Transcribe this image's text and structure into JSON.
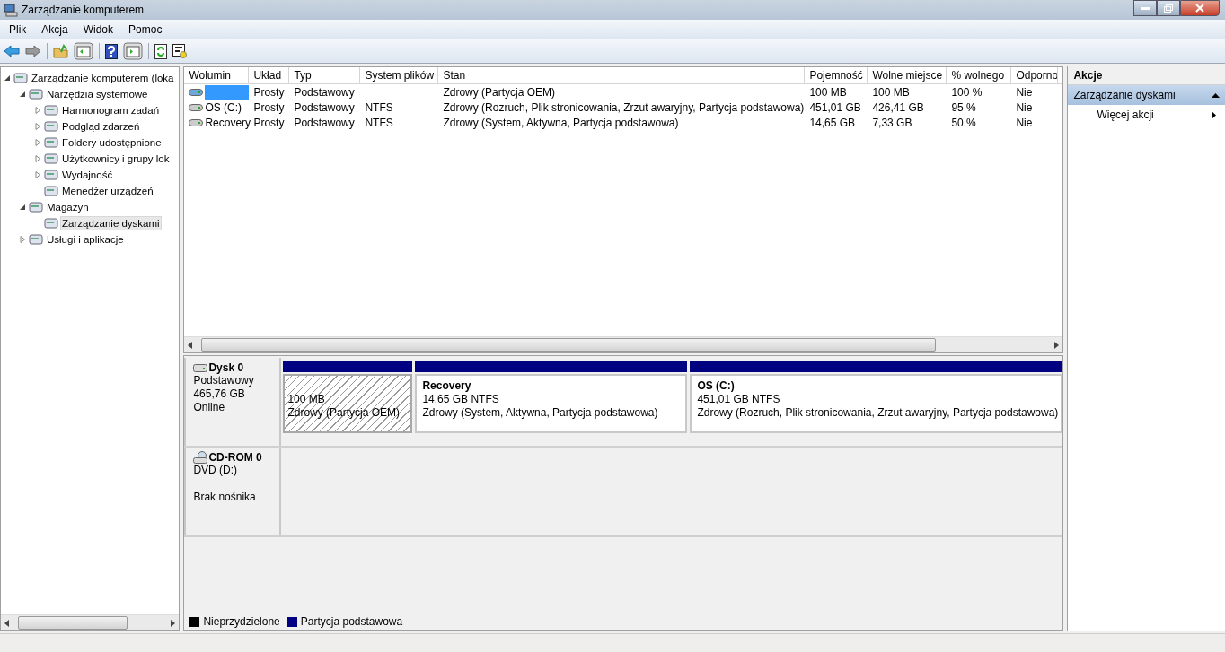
{
  "window": {
    "title": "Zarządzanie komputerem"
  },
  "menu": [
    "Plik",
    "Akcja",
    "Widok",
    "Pomoc"
  ],
  "tree": [
    {
      "label": "Zarządzanie komputerem (loka",
      "expanded": true,
      "selected": false,
      "children": [
        {
          "label": "Narzędzia systemowe",
          "expanded": true,
          "selected": false,
          "children": [
            {
              "label": "Harmonogram zadań",
              "expanded": false,
              "selected": false
            },
            {
              "label": "Podgląd zdarzeń",
              "expanded": false,
              "selected": false
            },
            {
              "label": "Foldery udostępnione",
              "expanded": false,
              "selected": false
            },
            {
              "label": "Użytkownicy i grupy lok",
              "expanded": false,
              "selected": false
            },
            {
              "label": "Wydajność",
              "expanded": false,
              "selected": false
            },
            {
              "label": "Menedżer urządzeń",
              "selected": false
            }
          ]
        },
        {
          "label": "Magazyn",
          "expanded": true,
          "selected": false,
          "children": [
            {
              "label": "Zarządzanie dyskami",
              "selected": true
            }
          ]
        },
        {
          "label": "Usługi i aplikacje",
          "expanded": false,
          "selected": false
        }
      ]
    }
  ],
  "table": {
    "columns": [
      "Wolumin",
      "Układ",
      "Typ",
      "System plików",
      "Stan",
      "Pojemność",
      "Wolne miejsce",
      "% wolnego",
      "Odporno"
    ],
    "rows": [
      {
        "selected": true,
        "cells": [
          "",
          "Prosty",
          "Podstawowy",
          "",
          "Zdrowy (Partycja OEM)",
          "100 MB",
          "100 MB",
          "100 %",
          "Nie"
        ]
      },
      {
        "selected": false,
        "cells": [
          "OS (C:)",
          "Prosty",
          "Podstawowy",
          "NTFS",
          "Zdrowy (Rozruch, Plik stronicowania, Zrzut awaryjny, Partycja podstawowa)",
          "451,01 GB",
          "426,41 GB",
          "95 %",
          "Nie"
        ]
      },
      {
        "selected": false,
        "cells": [
          "Recovery",
          "Prosty",
          "Podstawowy",
          "NTFS",
          "Zdrowy (System, Aktywna, Partycja podstawowa)",
          "14,65 GB",
          "7,33 GB",
          "50 %",
          "Nie"
        ]
      }
    ]
  },
  "disks": [
    {
      "kind": "disk",
      "name": "Dysk 0",
      "lines": [
        "Podstawowy",
        "465,76 GB"
      ],
      "status": "Online",
      "partitions": [
        {
          "kind": "oem",
          "lines": [
            "100 MB",
            "Zdrowy (Partycja OEM)"
          ]
        },
        {
          "kind": "primary",
          "title": "Recovery",
          "lines": [
            "14,65 GB NTFS",
            "Zdrowy (System, Aktywna, Partycja podstawowa)"
          ]
        },
        {
          "kind": "primary",
          "title": "OS  (C:)",
          "lines": [
            "451,01 GB NTFS",
            "Zdrowy (Rozruch, Plik stronicowania, Zrzut awaryjny, Partycja podstawowa)"
          ]
        }
      ]
    },
    {
      "kind": "cdrom",
      "name": "CD-ROM 0",
      "lines": [
        "DVD (D:)"
      ],
      "status": "Brak nośnika"
    }
  ],
  "legend": [
    {
      "label": "Nieprzydzielone",
      "color": "#000000"
    },
    {
      "label": "Partycja podstawowa",
      "color": "#000080"
    }
  ],
  "actions": {
    "title": "Akcje",
    "section": {
      "label": "Zarządzanie dyskami",
      "expanded": true
    },
    "items": [
      "Więcej akcji"
    ]
  }
}
